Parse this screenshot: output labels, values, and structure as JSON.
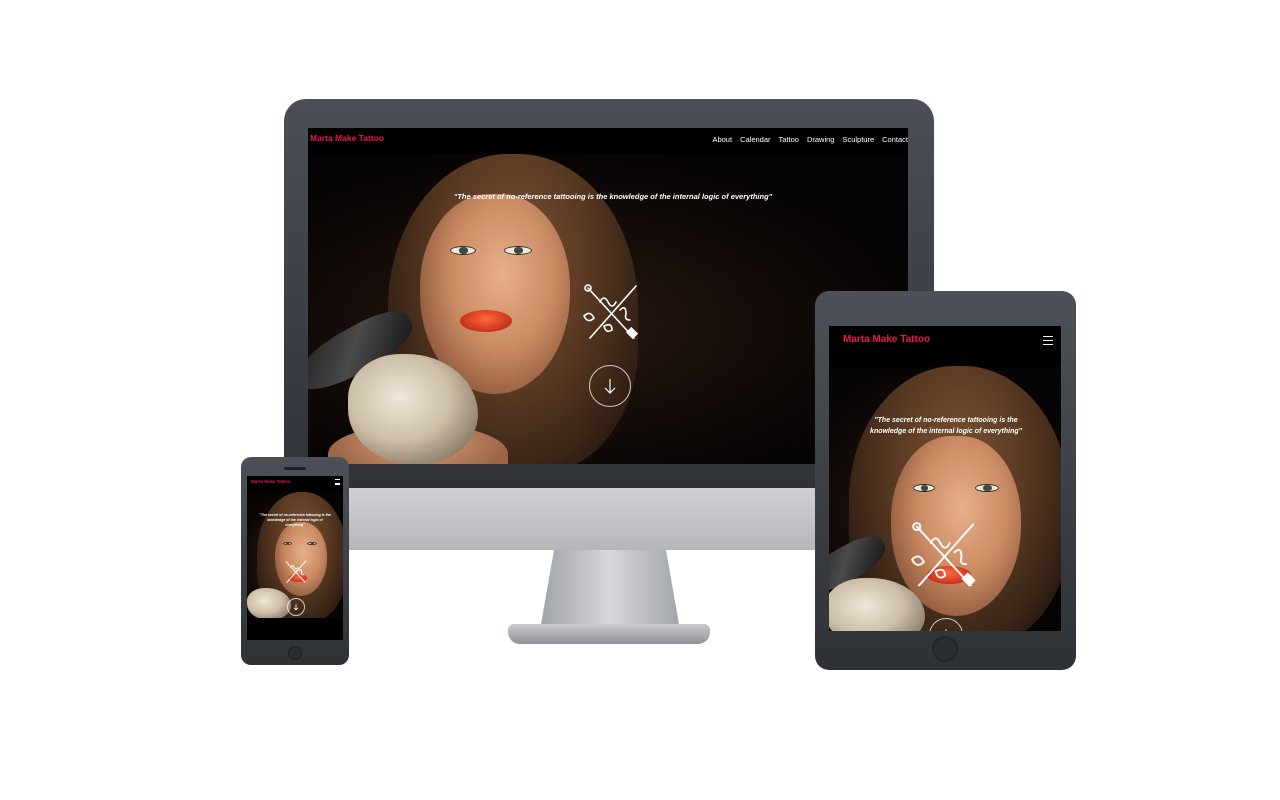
{
  "brand": "Marta Make Tattoo",
  "nav": {
    "items": [
      "About",
      "Calendar",
      "Tattoo",
      "Drawing",
      "Sculpture",
      "Contact"
    ]
  },
  "hero": {
    "quote": "\"The secret of no-reference tattooing is the knowledge of the internal logic of everything\""
  },
  "icons": {
    "menu": "hamburger-menu-icon",
    "scroll": "arrow-down-icon",
    "logo_mark": "crossed-needles-logo"
  },
  "colors": {
    "brand_red": "#e8194f",
    "background": "#000000",
    "device_frame": "#3a3e44"
  }
}
